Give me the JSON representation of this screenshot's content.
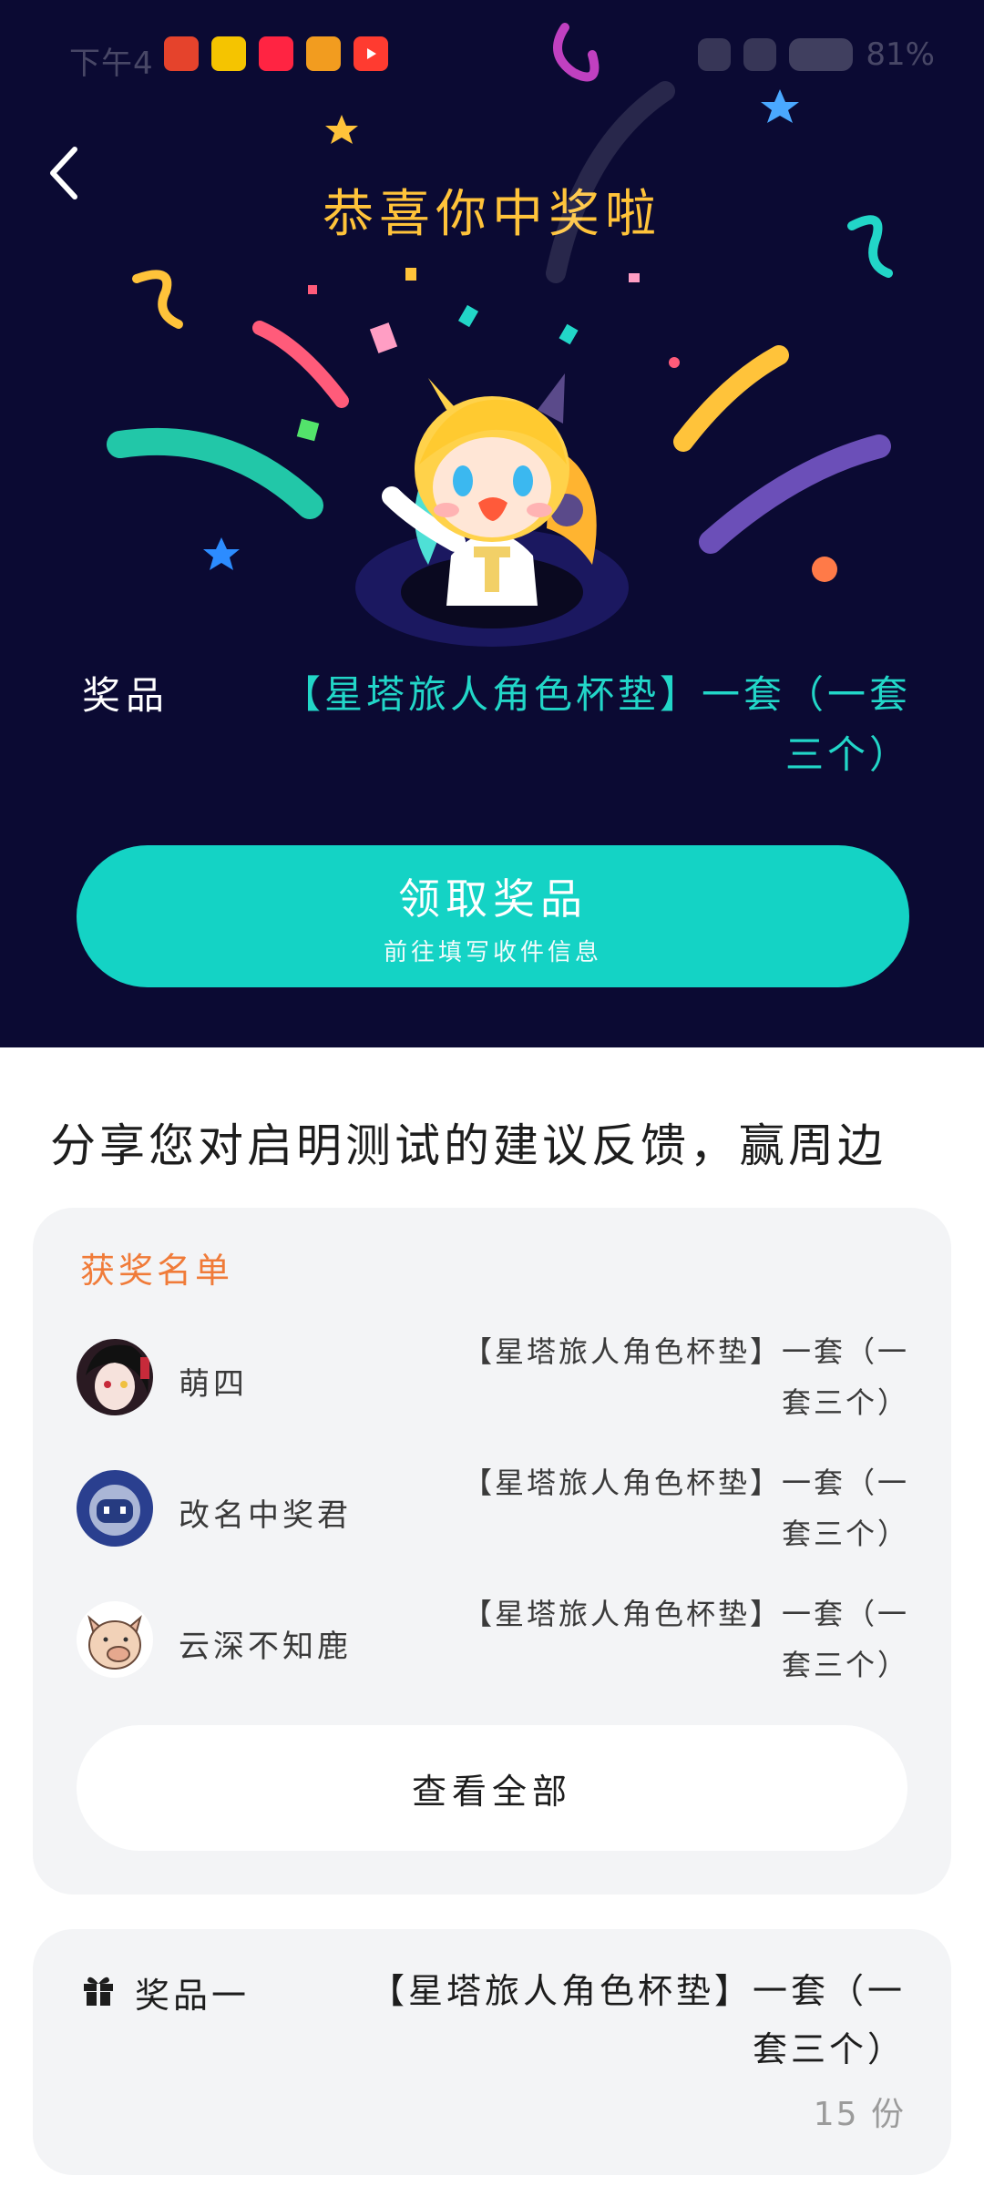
{
  "status_bar": {
    "time": "下午4",
    "battery": "81%"
  },
  "hero": {
    "title": "恭喜你中奖啦",
    "prize_label": "奖品",
    "prize_name": "【星塔旅人角色杯垫】一套（一套三个）",
    "claim_button": {
      "label": "领取奖品",
      "sub_label": "前往填写收件信息"
    }
  },
  "section": {
    "heading": "分享您对启明测试的建议反馈，赢周边"
  },
  "winners": {
    "title": "获奖名单",
    "items": [
      {
        "name": "萌四",
        "prize": "【星塔旅人角色杯垫】一套（一套三个）"
      },
      {
        "name": "改名中奖君",
        "prize": "【星塔旅人角色杯垫】一套（一套三个）"
      },
      {
        "name": "云深不知鹿",
        "prize": "【星塔旅人角色杯垫】一套（一套三个）"
      }
    ],
    "view_all": "查看全部"
  },
  "prize_card": {
    "label": "奖品一",
    "name": "【星塔旅人角色杯垫】一套（一套三个）",
    "quantity": "15 份"
  },
  "colors": {
    "hero_bg": "#0b0a33",
    "accent": "#14d3c5",
    "title_gold": "#ffc33a",
    "winners_title": "#f07b39"
  }
}
